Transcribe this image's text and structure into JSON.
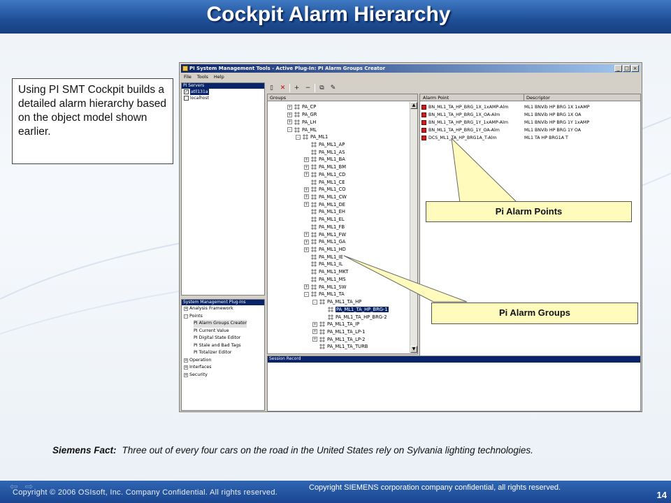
{
  "slide": {
    "title": "Cockpit Alarm Hierarchy",
    "callout_text": "Using PI SMT Cockpit builds a detailed alarm hierarchy based on the object model shown earlier.",
    "fact_label": "Siemens Fact:",
    "fact_text": "Three out of every four cars on the road in the United States rely on Sylvania lighting technologies.",
    "footer_left": "Copyright © 2006 OSIsoft, Inc. Company Confidential. All rights reserved.",
    "footer_right": "Copyright SIEMENS corporation company confidential, all rights reserved.",
    "page_number": "14"
  },
  "labels": {
    "alarm_points": "Pi Alarm Points",
    "alarm_groups": "Pi Alarm Groups"
  },
  "app": {
    "title": "PI System Management Tools - Active Plug-In: PI Alarm Groups Creator",
    "menu": [
      "File",
      "Tools",
      "Help"
    ],
    "servers_header": "PI Servers",
    "servers": [
      {
        "name": "atll131a",
        "checked": true,
        "selected": true
      },
      {
        "name": "localhost",
        "checked": false,
        "selected": false
      }
    ],
    "plugins_header": "System Management Plug-Ins",
    "plugins": [
      {
        "label": "Analysis Framework",
        "toggle": "+",
        "indent": 0
      },
      {
        "label": "Points",
        "toggle": "-",
        "indent": 0
      },
      {
        "label": "PI Alarm Groups Creator",
        "toggle": "",
        "indent": 1,
        "selected": true
      },
      {
        "label": "PI Current Value",
        "toggle": "",
        "indent": 1
      },
      {
        "label": "PI Digital State Editor",
        "toggle": "",
        "indent": 1
      },
      {
        "label": "PI Stale and Bad Tags",
        "toggle": "",
        "indent": 1
      },
      {
        "label": "PI Totalizer Editor",
        "toggle": "",
        "indent": 1
      },
      {
        "label": "Operation",
        "toggle": "+",
        "indent": 0
      },
      {
        "label": "Interfaces",
        "toggle": "+",
        "indent": 0
      },
      {
        "label": "Security",
        "toggle": "+",
        "indent": 0
      }
    ],
    "groups_header": "Groups",
    "groups": [
      {
        "label": "PA_CP",
        "toggle": "+",
        "indent": 0
      },
      {
        "label": "PA_GR",
        "toggle": "+",
        "indent": 0
      },
      {
        "label": "PA_LH",
        "toggle": "+",
        "indent": 0
      },
      {
        "label": "PA_ML",
        "toggle": "-",
        "indent": 0
      },
      {
        "label": "PA_ML1",
        "toggle": "-",
        "indent": 1
      },
      {
        "label": "PA_ML1_AP",
        "toggle": "",
        "indent": 2
      },
      {
        "label": "PA_ML1_AS",
        "toggle": "",
        "indent": 2
      },
      {
        "label": "PA_ML1_BA",
        "toggle": "+",
        "indent": 2
      },
      {
        "label": "PA_ML1_BM",
        "toggle": "+",
        "indent": 2
      },
      {
        "label": "PA_ML1_CD",
        "toggle": "+",
        "indent": 2
      },
      {
        "label": "PA_ML1_CE",
        "toggle": "",
        "indent": 2
      },
      {
        "label": "PA_ML1_CO",
        "toggle": "+",
        "indent": 2
      },
      {
        "label": "PA_ML1_CW",
        "toggle": "+",
        "indent": 2
      },
      {
        "label": "PA_ML1_DE",
        "toggle": "+",
        "indent": 2
      },
      {
        "label": "PA_ML1_EH",
        "toggle": "",
        "indent": 2
      },
      {
        "label": "PA_ML1_EL",
        "toggle": "",
        "indent": 2
      },
      {
        "label": "PA_ML1_FB",
        "toggle": "",
        "indent": 2
      },
      {
        "label": "PA_ML1_FW",
        "toggle": "+",
        "indent": 2
      },
      {
        "label": "PA_ML1_GA",
        "toggle": "+",
        "indent": 2
      },
      {
        "label": "PA_ML1_HD",
        "toggle": "+",
        "indent": 2
      },
      {
        "label": "PA_ML1_IE",
        "toggle": "",
        "indent": 2
      },
      {
        "label": "PA_ML1_IL",
        "toggle": "",
        "indent": 2
      },
      {
        "label": "PA_ML1_MKT",
        "toggle": "",
        "indent": 2
      },
      {
        "label": "PA_ML1_MS",
        "toggle": "",
        "indent": 2
      },
      {
        "label": "PA_ML1_SW",
        "toggle": "+",
        "indent": 2
      },
      {
        "label": "PA_ML1_TA",
        "toggle": "-",
        "indent": 2
      },
      {
        "label": "PA_ML1_TA_HP",
        "toggle": "-",
        "indent": 3
      },
      {
        "label": "PA_ML1_TA_HP_BRG-1",
        "toggle": "",
        "indent": 4,
        "selected": true
      },
      {
        "label": "PA_ML1_TA_HP_BRG-2",
        "toggle": "",
        "indent": 4
      },
      {
        "label": "PA_ML1_TA_IP",
        "toggle": "+",
        "indent": 3
      },
      {
        "label": "PA_ML1_TA_LP-1",
        "toggle": "+",
        "indent": 3
      },
      {
        "label": "PA_ML1_TA_LP-2",
        "toggle": "+",
        "indent": 3
      },
      {
        "label": "PA_ML1_TA_TURB",
        "toggle": "",
        "indent": 3
      }
    ],
    "points_columns": {
      "point": "Alarm Point",
      "descriptor": "Descriptor"
    },
    "points": [
      {
        "name": "BN_ML1_TA_HP_BRG_1X_1xAMP-Alm",
        "descriptor": "ML1 BNVib HP BRG 1X 1xAMP"
      },
      {
        "name": "BN_ML1_TA_HP_BRG_1X_OA-Alm",
        "descriptor": "ML1 BNVib HP BRG 1X OA"
      },
      {
        "name": "BN_ML1_TA_HP_BRG_1Y_1xAMP-Alm",
        "descriptor": "ML1 BNVib HP BRG 1Y 1xAMP"
      },
      {
        "name": "BN_ML1_TA_HP_BRG_1Y_OA-Alm",
        "descriptor": "ML1 BNVib HP BRG 1Y OA"
      },
      {
        "name": "DCS_ML1_TA_HP_BRG1A_T-Alm",
        "descriptor": "ML1 TA HP BRG1A T"
      }
    ],
    "session_header": "Session Record"
  },
  "colors": {
    "banner": "#1e4f97",
    "label_fill": "#fffbbd",
    "selection": "#0a246a",
    "alarm_icon": "#c81e1e"
  }
}
